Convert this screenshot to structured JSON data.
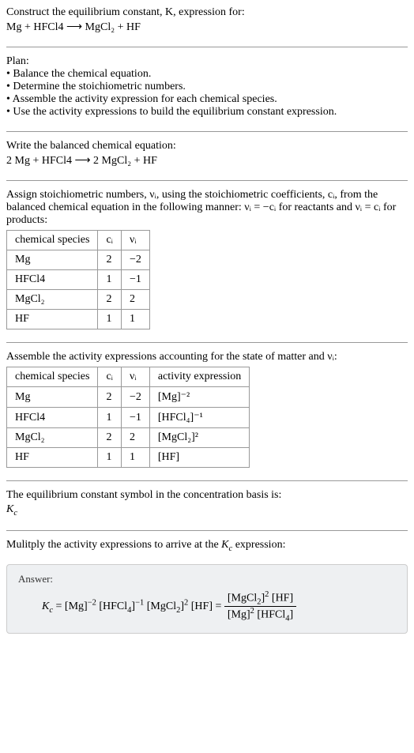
{
  "intro": {
    "line1": "Construct the equilibrium constant, K, expression for:",
    "line2": "Mg + HFCl4 ⟶ MgCl₂ + HF"
  },
  "plan": {
    "heading": "Plan:",
    "items": [
      "• Balance the chemical equation.",
      "• Determine the stoichiometric numbers.",
      "• Assemble the activity expression for each chemical species.",
      "• Use the activity expressions to build the equilibrium constant expression."
    ]
  },
  "balanced": {
    "heading": "Write the balanced chemical equation:",
    "eq": "2 Mg + HFCl4 ⟶ 2 MgCl₂ + HF"
  },
  "stoich": {
    "text": "Assign stoichiometric numbers, νᵢ, using the stoichiometric coefficients, cᵢ, from the balanced chemical equation in the following manner: νᵢ = −cᵢ for reactants and νᵢ = cᵢ for products:",
    "headers": [
      "chemical species",
      "cᵢ",
      "νᵢ"
    ],
    "rows": [
      [
        "Mg",
        "2",
        "−2"
      ],
      [
        "HFCl4",
        "1",
        "−1"
      ],
      [
        "MgCl₂",
        "2",
        "2"
      ],
      [
        "HF",
        "1",
        "1"
      ]
    ]
  },
  "activity": {
    "text": "Assemble the activity expressions accounting for the state of matter and νᵢ:",
    "headers": [
      "chemical species",
      "cᵢ",
      "νᵢ",
      "activity expression"
    ],
    "rows": [
      [
        "Mg",
        "2",
        "−2",
        "[Mg]⁻²"
      ],
      [
        "HFCl4",
        "1",
        "−1",
        "[HFCl₄]⁻¹"
      ],
      [
        "MgCl₂",
        "2",
        "2",
        "[MgCl₂]²"
      ],
      [
        "HF",
        "1",
        "1",
        "[HF]"
      ]
    ]
  },
  "kcSymbol": {
    "text": "The equilibrium constant symbol in the concentration basis is:",
    "symbol": "K_c"
  },
  "multiply": {
    "text": "Mulitply the activity expressions to arrive at the K_c expression:"
  },
  "answer": {
    "label": "Answer:",
    "lhs": "K_c = [Mg]⁻² [HFCl₄]⁻¹ [MgCl₂]² [HF] =",
    "num": "[MgCl₂]² [HF]",
    "den": "[Mg]² [HFCl₄]"
  }
}
